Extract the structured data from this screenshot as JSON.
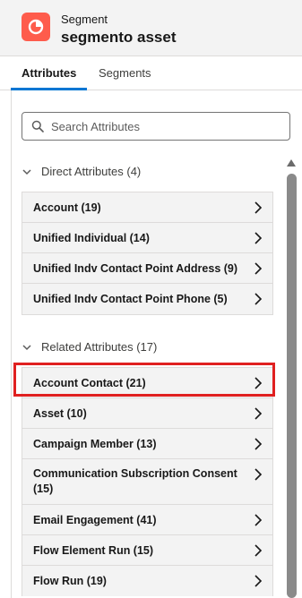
{
  "header": {
    "subtitle": "Segment",
    "title": "segmento asset",
    "icon": "segment-pie-icon",
    "icon_color": "#fe5c4c"
  },
  "tabs": [
    {
      "label": "Attributes",
      "active": true
    },
    {
      "label": "Segments",
      "active": false
    }
  ],
  "search": {
    "placeholder": "Search Attributes",
    "value": ""
  },
  "direct": {
    "label": "Direct Attributes (4)",
    "items": [
      {
        "label": "Account (19)"
      },
      {
        "label": "Unified Individual (14)"
      },
      {
        "label": "Unified Indv Contact Point Address (9)"
      },
      {
        "label": "Unified Indv Contact Point Phone (5)"
      }
    ]
  },
  "related": {
    "label": "Related Attributes (17)",
    "items": [
      {
        "label": "Account Contact (21)"
      },
      {
        "label": "Asset (10)"
      },
      {
        "label": "Campaign Member (13)"
      },
      {
        "label": "Communication Subscription Consent (15)"
      },
      {
        "label": "Email Engagement (41)"
      },
      {
        "label": "Flow Element Run (15)"
      },
      {
        "label": "Flow Run (19)"
      }
    ]
  },
  "colors": {
    "accent": "#0176d3",
    "highlight": "#e02020"
  }
}
